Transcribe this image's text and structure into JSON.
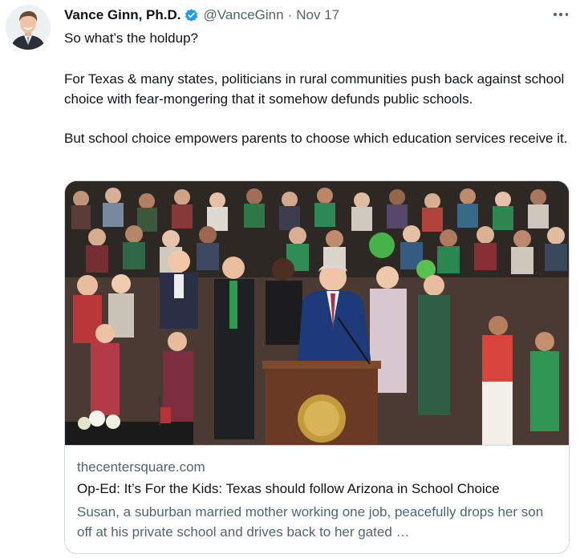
{
  "author": {
    "display_name": "Vance Ginn, Ph.D.",
    "handle": "@VanceGinn",
    "separator": "·",
    "date": "Nov 17",
    "verified_color": "#1d9bf0"
  },
  "tweet": {
    "paragraphs": [
      "So what’s the holdup?",
      "For Texas & many states, politicians in rural communities push back against school choice with fear-mongering that it somehow defunds public schools.",
      "But school choice empowers parents to choose which education services receive it."
    ]
  },
  "link_card": {
    "domain": "thecentersquare.com",
    "title": "Op-Ed: It’s For the Kids: Texas should follow Arizona in School Choice",
    "description": "Susan, a suburban married mother working one job, peacefully drops her son off at his private school and drives back to her gated …"
  },
  "icons": {
    "verified": "verified-badge-icon",
    "more": "more-options-icon"
  },
  "colors": {
    "text_primary": "#0f1419",
    "text_secondary": "#536471",
    "border": "#cfd9de",
    "accent": "#1d9bf0"
  }
}
